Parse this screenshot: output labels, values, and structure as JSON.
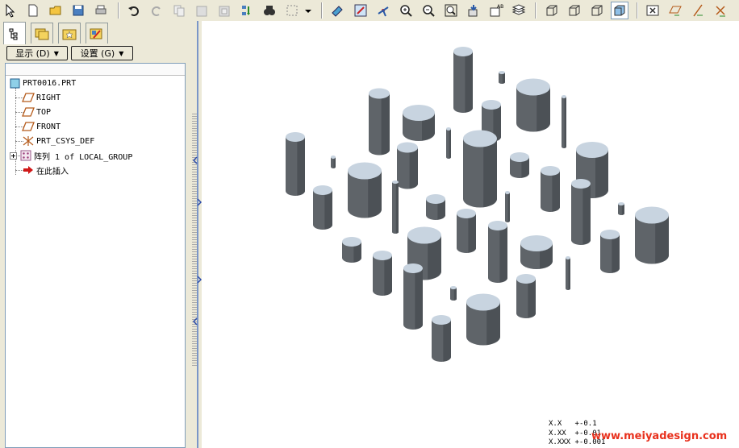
{
  "toolbar": {
    "buttons": [
      {
        "icon": "select-arrow-icon"
      },
      {
        "icon": "new-file-icon"
      },
      {
        "icon": "open-folder-icon"
      },
      {
        "icon": "save-icon"
      },
      {
        "icon": "print-icon"
      },
      {
        "icon": "undo-icon"
      },
      {
        "icon": "redo-icon"
      },
      {
        "icon": "copy-icon"
      },
      {
        "icon": "paste-icon"
      },
      {
        "icon": "paste-special-icon"
      },
      {
        "icon": "regenerate-icon"
      },
      {
        "icon": "find-binoculars-icon"
      },
      {
        "icon": "selection-box-icon"
      },
      {
        "icon": "dropdown-arrow-icon"
      },
      {
        "icon": "repaint-icon"
      },
      {
        "icon": "orient-icon"
      },
      {
        "icon": "spin-center-icon"
      },
      {
        "icon": "zoom-in-icon"
      },
      {
        "icon": "zoom-out-icon"
      },
      {
        "icon": "zoom-fit-icon"
      },
      {
        "icon": "reorient-icon"
      },
      {
        "icon": "saved-views-icon"
      },
      {
        "icon": "layers-icon"
      },
      {
        "icon": "wireframe-icon"
      },
      {
        "icon": "hidden-line-icon"
      },
      {
        "icon": "no-hidden-icon"
      },
      {
        "icon": "shading-icon"
      },
      {
        "icon": "close-window-icon"
      },
      {
        "icon": "datum-plane-display-icon"
      },
      {
        "icon": "datum-axis-display-icon"
      },
      {
        "icon": "csys-display-icon"
      }
    ]
  },
  "left_panel": {
    "tabs": [
      {
        "icon": "model-tree-icon",
        "active": true
      },
      {
        "icon": "folder-browser-icon",
        "active": false
      },
      {
        "icon": "favorites-icon",
        "active": false
      },
      {
        "icon": "connections-icon",
        "active": false
      }
    ],
    "display_menu": "显示 (D)",
    "settings_menu": "设置 (G)"
  },
  "model_tree": {
    "root": "PRT0016.PRT",
    "items": [
      {
        "label": "RIGHT",
        "icon": "datum-plane-icon"
      },
      {
        "label": "TOP",
        "icon": "datum-plane-icon"
      },
      {
        "label": "FRONT",
        "icon": "datum-plane-icon"
      },
      {
        "label": "PRT_CSYS_DEF",
        "icon": "coordinate-system-icon"
      },
      {
        "label": "阵列 1 of LOCAL_GROUP",
        "icon": "pattern-icon"
      },
      {
        "label": "在此插入",
        "icon": "insert-here-arrow-icon"
      }
    ]
  },
  "viewport": {
    "tolerances": [
      {
        "format": "X.X",
        "value": "+-0.1"
      },
      {
        "format": "X.XX",
        "value": "+-0.01"
      },
      {
        "format": "X.XXX",
        "value": "+-0.001"
      }
    ],
    "watermark": "www.meiyadesign.com",
    "colors": {
      "cylinder_side": "#5f6469",
      "cylinder_top": "#c8d4e0"
    }
  }
}
